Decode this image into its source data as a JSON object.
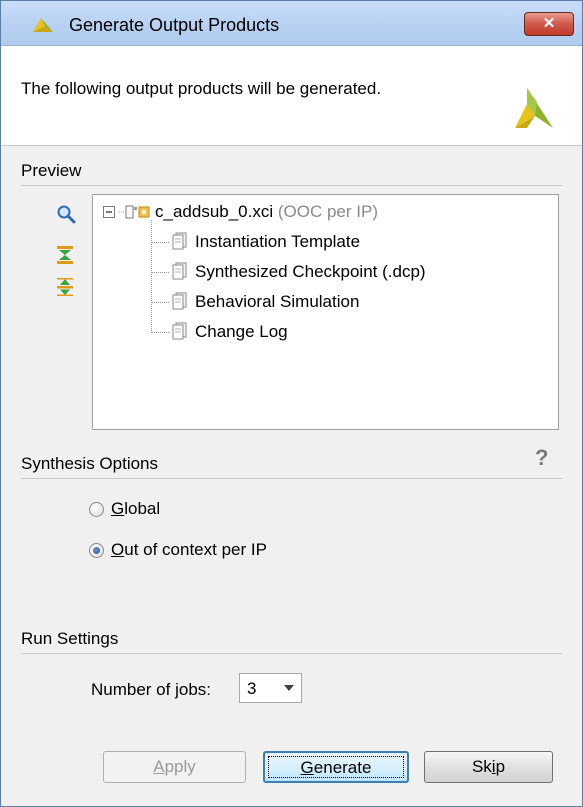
{
  "window": {
    "title": "Generate Output Products",
    "close_label": "✕"
  },
  "header": {
    "text": "The following output products will be generated."
  },
  "preview": {
    "title": "Preview",
    "root": {
      "name": "c_addsub_0.xci",
      "detail": "(OOC per IP)"
    },
    "items": [
      {
        "label": "Instantiation Template"
      },
      {
        "label": "Synthesized Checkpoint (.dcp)"
      },
      {
        "label": "Behavioral Simulation"
      },
      {
        "label": "Change Log"
      }
    ],
    "tools": [
      "search-icon",
      "collapse-all-icon",
      "expand-all-icon"
    ]
  },
  "synthesis": {
    "title": "Synthesis Options",
    "help": "?",
    "options": [
      {
        "mnemonic": "G",
        "rest": "lobal",
        "checked": false
      },
      {
        "mnemonic": "O",
        "rest": "ut of context per IP",
        "checked": true
      }
    ]
  },
  "run": {
    "title": "Run Settings",
    "jobs_prefix": "Number of ",
    "jobs_mnemonic": "j",
    "jobs_suffix": "obs:",
    "jobs_value": "3"
  },
  "buttons": {
    "apply_m": "A",
    "apply_rest": "pply",
    "generate_pre": "",
    "generate_m": "G",
    "generate_rest": "enerate",
    "skip_pre": "Sk",
    "skip_m": "i",
    "skip_rest": "p"
  },
  "colors": {
    "accent": "#3c7fb1",
    "logo_yellow": "#e8c21a",
    "logo_green": "#8db32c"
  }
}
